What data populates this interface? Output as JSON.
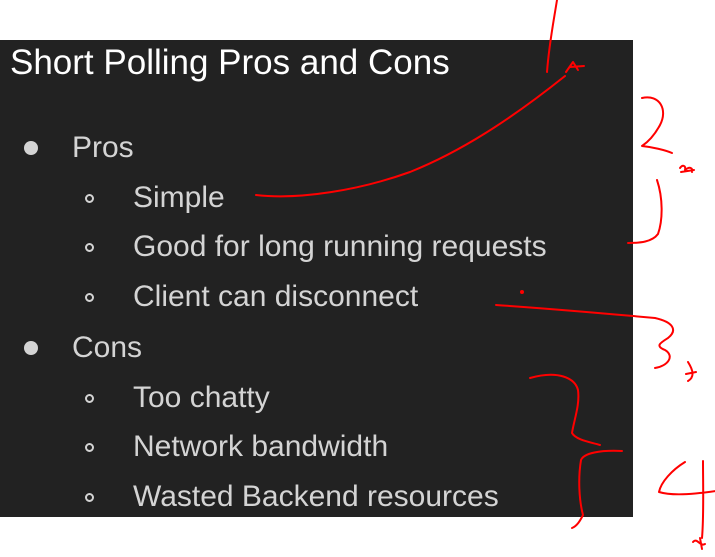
{
  "slide": {
    "title": "Short Polling Pros and Cons",
    "pros": {
      "heading": "Pros",
      "items": [
        "Simple",
        "Good for long running requests",
        "Client can disconnect"
      ]
    },
    "cons": {
      "heading": "Cons",
      "items": [
        "Too chatty",
        "Network bandwidth",
        "Wasted Backend resources"
      ]
    }
  },
  "annotations": {
    "ink_color": "#ff0000",
    "numbers": [
      "2",
      "3",
      "4"
    ]
  }
}
